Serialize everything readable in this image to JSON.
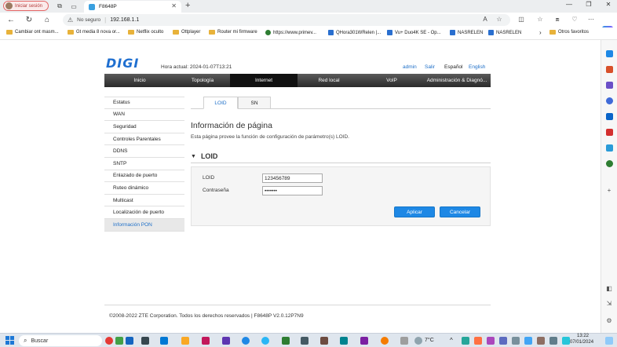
{
  "browser": {
    "profile_label": "Iniciar sesión",
    "tab_title": "F8648P",
    "tab_close": "✕",
    "new_tab": "+",
    "security_label": "No seguro",
    "url": "192.168.1.1",
    "window_controls": [
      "—",
      "❐",
      "✕"
    ],
    "bookmarks": [
      {
        "label": "Cambiar ont masm...",
        "icon": "folder-icon"
      },
      {
        "label": "Gt media 8 nova or...",
        "icon": "folder-icon"
      },
      {
        "label": "Netflix oculto",
        "icon": "folder-icon"
      },
      {
        "label": "Ottplayer",
        "icon": "folder-icon"
      },
      {
        "label": "Router mi firmware",
        "icon": "folder-icon"
      },
      {
        "label": "https://www.primev...",
        "icon": "play-icon"
      },
      {
        "label": "QHora301WRelen |...",
        "icon": "site-icon"
      },
      {
        "label": "Vu+ Duo4K SE - Op...",
        "icon": "site-icon"
      },
      {
        "label": "NASRELEN",
        "icon": "site-icon"
      },
      {
        "label": "NASRELEN",
        "icon": "site-icon"
      }
    ],
    "bookmarks_more": "›",
    "other_favorites": "Otros favoritos"
  },
  "header": {
    "logo": "DIGI",
    "current_time": "Hora actual: 2024-01-07T13:21",
    "user": "admin",
    "logout": "Salir",
    "lang_es": "Español",
    "lang_en": "English"
  },
  "nav": {
    "items": [
      "Inicio",
      "Topología",
      "Internet",
      "Red local",
      "VoIP",
      "Administración & Diagnó..."
    ],
    "active": "Internet"
  },
  "sidebar": {
    "items": [
      "Estatus",
      "WAN",
      "Seguridad",
      "Controles Parentales",
      "DDNS",
      "SNTP",
      "Enlazado de puerto",
      "Ruteo dinámico",
      "Multicast",
      "Localización de puerto",
      "Información PON"
    ],
    "active": "Información PON"
  },
  "subtabs": [
    "LOID",
    "SN"
  ],
  "main": {
    "title": "Información de página",
    "description": "Esta página provee la función de configuración de parámetro(s) LOID.",
    "section_arrow": "▼",
    "section_title": "LOID",
    "loid_label": "LOID",
    "loid_value": "123456789",
    "password_label": "Contraseña",
    "password_value": "1234567",
    "apply_label": "Aplicar",
    "cancel_label": "Cancelar"
  },
  "footer": {
    "text": "©2008-2022 ZTE Corporation. Todos los derechos reservados  |   F8648P V2.0.12P7N9"
  },
  "taskbar": {
    "search_placeholder": "Buscar",
    "temperature": "7°C",
    "time": "13:22",
    "date": "07/01/2024"
  },
  "colors": {
    "accent": "#1e88e5",
    "nav_bg": "#2a2a2a",
    "link": "#1e6fc8"
  }
}
